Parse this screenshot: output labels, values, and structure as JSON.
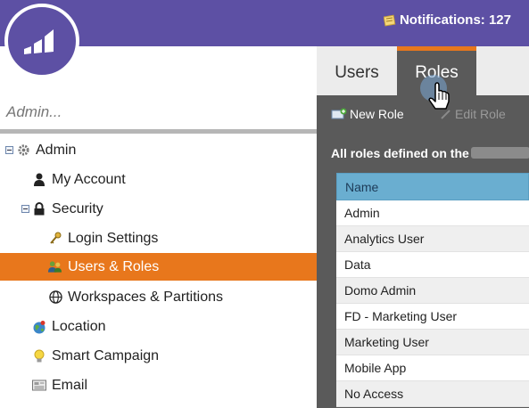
{
  "header": {
    "notifications_label": "Notifications: 127",
    "brand_color": "#5d50a4",
    "logo_icon": "marketo-bars-logo"
  },
  "sidebar": {
    "search_placeholder": "Admin...",
    "items": [
      {
        "label": "Admin",
        "icon": "gear-icon",
        "expanded": true
      },
      {
        "label": "My Account",
        "icon": "person-icon"
      },
      {
        "label": "Security",
        "icon": "lock-icon",
        "expanded": true
      },
      {
        "label": "Login Settings",
        "icon": "keys-icon"
      },
      {
        "label": "Users & Roles",
        "icon": "users-icon",
        "selected": true
      },
      {
        "label": "Workspaces & Partitions",
        "icon": "globe-grid-icon"
      },
      {
        "label": "Location",
        "icon": "globe-icon"
      },
      {
        "label": "Smart Campaign",
        "icon": "lightbulb-icon"
      },
      {
        "label": "Email",
        "icon": "email-icon"
      }
    ],
    "selected_color": "#e8771c"
  },
  "main": {
    "tabs": [
      {
        "label": "Users",
        "active": false
      },
      {
        "label": "Roles",
        "active": true
      }
    ],
    "toolbar": {
      "new_role_label": "New Role",
      "edit_role_label": "Edit Role"
    },
    "description": "All roles defined on the",
    "table": {
      "columns": [
        "Name"
      ],
      "rows": [
        "Admin",
        "Analytics User",
        "Data",
        "Domo Admin",
        "FD - Marketing User",
        "Marketing User",
        "Mobile App",
        "No Access"
      ]
    }
  }
}
